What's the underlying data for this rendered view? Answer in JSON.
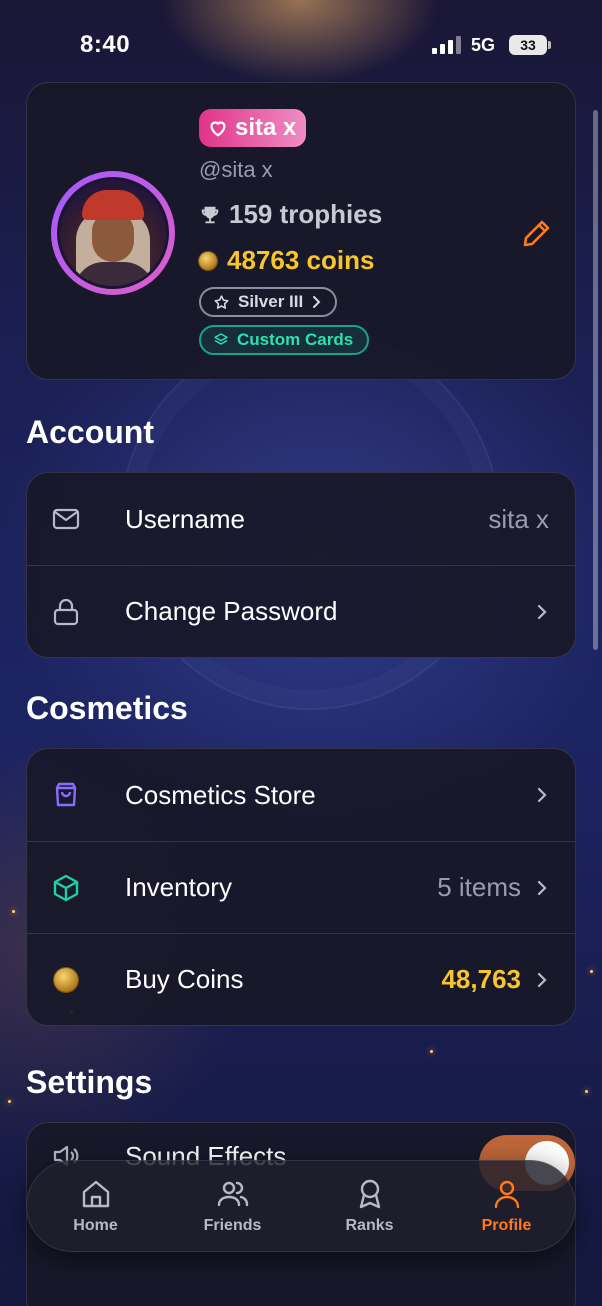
{
  "status_bar": {
    "time": "8:40",
    "network": "5G",
    "battery": "33"
  },
  "profile": {
    "display_name": "sita x",
    "handle": "@sita x",
    "trophies": "159 trophies",
    "coins": "48763 coins",
    "rank": "Silver III",
    "custom_cards": "Custom Cards"
  },
  "sections": {
    "account": {
      "title": "Account",
      "username_label": "Username",
      "username_value": "sita x",
      "password_label": "Change Password"
    },
    "cosmetics": {
      "title": "Cosmetics",
      "store_label": "Cosmetics Store",
      "inventory_label": "Inventory",
      "inventory_value": "5 items",
      "buy_coins_label": "Buy Coins",
      "buy_coins_value": "48,763"
    },
    "settings": {
      "title": "Settings",
      "sound_label": "Sound Effects",
      "sound_enabled": true
    }
  },
  "tab_bar": {
    "tabs": [
      {
        "label": "Home",
        "icon": "home-icon"
      },
      {
        "label": "Friends",
        "icon": "friends-icon"
      },
      {
        "label": "Ranks",
        "icon": "award-icon"
      },
      {
        "label": "Profile",
        "icon": "user-icon"
      }
    ],
    "active": "Profile"
  },
  "colors": {
    "accent": "#ff7a1a",
    "coin_gold": "#f8c52b",
    "name_pill": "#e0338a",
    "custom_cards": "#2ee0b0"
  }
}
